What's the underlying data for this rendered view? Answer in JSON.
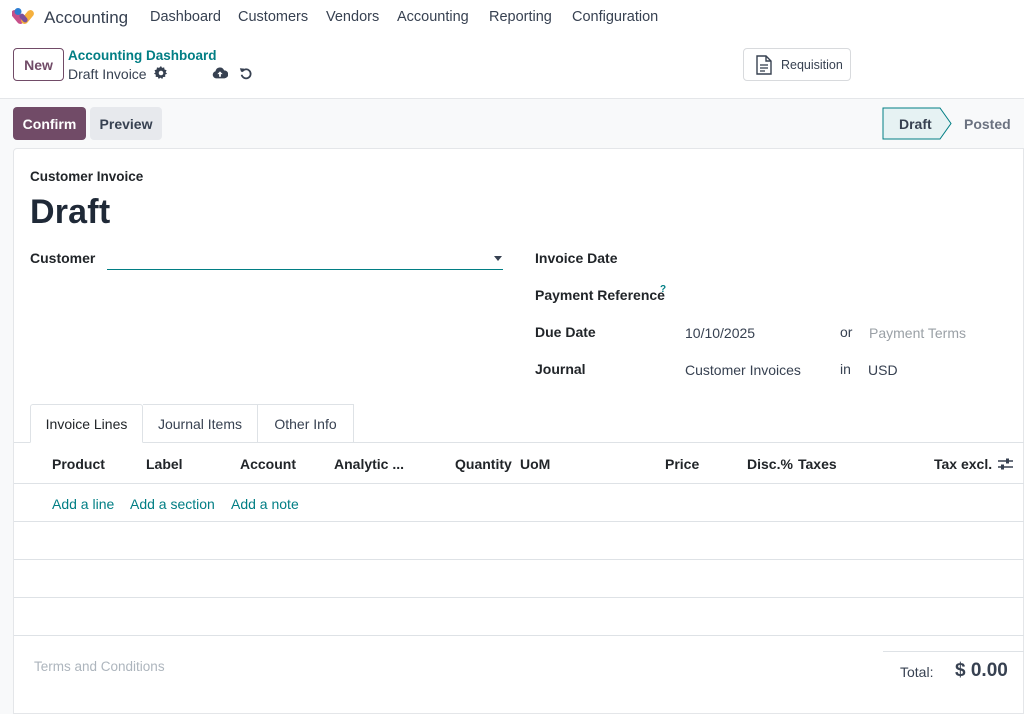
{
  "app": {
    "name": "Accounting"
  },
  "menu": [
    "Dashboard",
    "Customers",
    "Vendors",
    "Accounting",
    "Reporting",
    "Configuration"
  ],
  "control": {
    "new_label": "New",
    "breadcrumb_parent": "Accounting Dashboard",
    "breadcrumb_current": "Draft Invoice",
    "requisition_label": "Requisition"
  },
  "actions": {
    "confirm": "Confirm",
    "preview": "Preview"
  },
  "statusbar": {
    "draft": "Draft",
    "posted": "Posted",
    "active": "Draft"
  },
  "form": {
    "type_label": "Customer Invoice",
    "title": "Draft",
    "customer_label": "Customer",
    "customer_value": "",
    "invoice_date_label": "Invoice Date",
    "payment_ref_label": "Payment Reference",
    "payment_ref_help": "?",
    "due_date_label": "Due Date",
    "due_date_value": "10/10/2025",
    "or_text": "or",
    "payment_terms_placeholder": "Payment Terms",
    "journal_label": "Journal",
    "journal_value": "Customer Invoices",
    "in_text": "in",
    "currency": "USD"
  },
  "tabs": [
    "Invoice Lines",
    "Journal Items",
    "Other Info"
  ],
  "table": {
    "columns": [
      "Product",
      "Label",
      "Account",
      "Analytic ...",
      "Quantity",
      "UoM",
      "Price",
      "Disc.%",
      "Taxes",
      "Tax excl."
    ],
    "add_line": "Add a line",
    "add_section": "Add a section",
    "add_note": "Add a note"
  },
  "footer": {
    "terms_placeholder": "Terms and Conditions",
    "total_label": "Total:",
    "total_value": "$ 0.00"
  },
  "colors": {
    "brand": "#714B67",
    "link": "#017e84"
  }
}
